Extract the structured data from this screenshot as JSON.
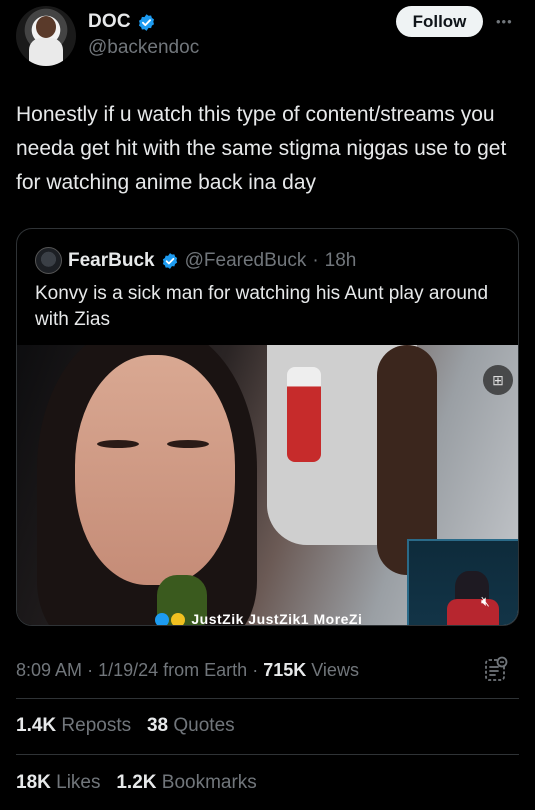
{
  "author": {
    "name": "DOC",
    "handle": "@backendoc",
    "verified_icon": "verified-badge-icon",
    "follow_label": "Follow",
    "more_label": "•••"
  },
  "tweet": {
    "text": "Honestly if u watch this type of content/streams you needa get hit with the same stigma niggas use to get for watching anime back ina day"
  },
  "quote": {
    "name": "FearBuck",
    "handle": "@FearedBuck",
    "separator": "·",
    "age": "18h",
    "text": "Konvy is a sick man for watching his Aunt play around with Zias",
    "media": {
      "socials_text": "JustZik  JustZik1  MoreZi",
      "overlay_icon": "sticker-icon",
      "mute_icon": "mute-icon"
    }
  },
  "meta": {
    "time": "8:09 AM",
    "sep1": "·",
    "date": "1/19/24 from Earth",
    "sep2": "·",
    "views_count": "715K",
    "views_label": "Views"
  },
  "stats": {
    "reposts_count": "1.4K",
    "reposts_label": "Reposts",
    "quotes_count": "38",
    "quotes_label": "Quotes",
    "likes_count": "18K",
    "likes_label": "Likes",
    "bookmarks_count": "1.2K",
    "bookmarks_label": "Bookmarks"
  },
  "colors": {
    "background": "#000000",
    "text": "#e7e9ea",
    "muted": "#71767b",
    "verified": "#1d9bf0",
    "divider": "#2f3336"
  }
}
